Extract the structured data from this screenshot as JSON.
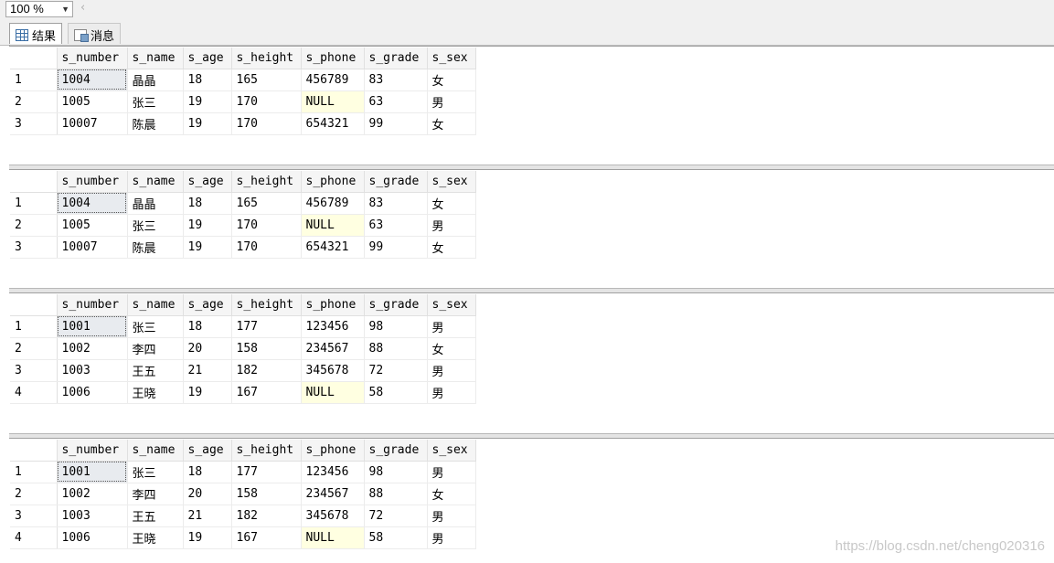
{
  "toolbar": {
    "zoom": "100 %"
  },
  "tabs": [
    {
      "label": "结果",
      "icon": "grid-icon"
    },
    {
      "label": "消息",
      "icon": "messages-icon"
    }
  ],
  "columns": [
    "s_number",
    "s_name",
    "s_age",
    "s_height",
    "s_phone",
    "s_grade",
    "s_sex"
  ],
  "grids": [
    {
      "rows": [
        [
          "1",
          "1004",
          "晶晶",
          "18",
          "165",
          "456789",
          "83",
          "女"
        ],
        [
          "2",
          "1005",
          "张三",
          "19",
          "170",
          "NULL",
          "63",
          "男"
        ],
        [
          "3",
          "10007",
          "陈晨",
          "19",
          "170",
          "654321",
          "99",
          "女"
        ]
      ]
    },
    {
      "rows": [
        [
          "1",
          "1004",
          "晶晶",
          "18",
          "165",
          "456789",
          "83",
          "女"
        ],
        [
          "2",
          "1005",
          "张三",
          "19",
          "170",
          "NULL",
          "63",
          "男"
        ],
        [
          "3",
          "10007",
          "陈晨",
          "19",
          "170",
          "654321",
          "99",
          "女"
        ]
      ]
    },
    {
      "rows": [
        [
          "1",
          "1001",
          "张三",
          "18",
          "177",
          "123456",
          "98",
          "男"
        ],
        [
          "2",
          "1002",
          "李四",
          "20",
          "158",
          "234567",
          "88",
          "女"
        ],
        [
          "3",
          "1003",
          "王五",
          "21",
          "182",
          "345678",
          "72",
          "男"
        ],
        [
          "4",
          "1006",
          "王晓",
          "19",
          "167",
          "NULL",
          "58",
          "男"
        ]
      ]
    },
    {
      "rows": [
        [
          "1",
          "1001",
          "张三",
          "18",
          "177",
          "123456",
          "98",
          "男"
        ],
        [
          "2",
          "1002",
          "李四",
          "20",
          "158",
          "234567",
          "88",
          "女"
        ],
        [
          "3",
          "1003",
          "王五",
          "21",
          "182",
          "345678",
          "72",
          "男"
        ],
        [
          "4",
          "1006",
          "王晓",
          "19",
          "167",
          "NULL",
          "58",
          "男"
        ]
      ]
    }
  ],
  "watermark": "https://blog.csdn.net/cheng020316"
}
